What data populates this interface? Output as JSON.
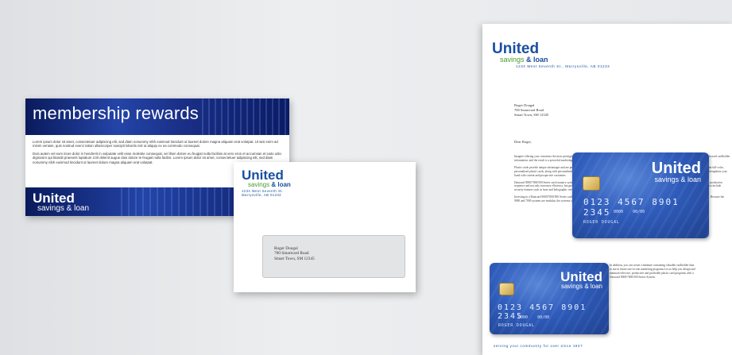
{
  "mailer": {
    "title": "membership rewards",
    "paragraph1": "Lorem ipsum dolor sit amet, consectetuer adipiscing elit, sed diam nonummy nibh euismod tincidunt ut laoreet dolore magna aliquam erat volutpat. Ut wisi enim ad minim veniam, quis nostrud exerci tation ullamcorper suscipit lobortis nisl ut aliquip ex ea commodo consequat.",
    "paragraph2": "Duis autem vel eum iriure dolor in hendrerit in vulputate velit esse molestie consequat, vel illum dolore eu feugiat nulla facilisis at vero eros et accumsan et iusto odio dignissim qui blandit praesent luptatum zzril delenit augue duis dolore te feugait nulla facilisi. Lorem ipsum dolor sit amet, consectetuer adipiscing elit, sed diam nonummy nibh euismod tincidunt ut laoreet dolore magna aliquam erat volutpat.",
    "logo_united": "United",
    "logo_sub": "savings & loan"
  },
  "envelope": {
    "logo_united": "United",
    "logo_savings": "savings",
    "logo_loan": "& loan",
    "return_line1": "1234 West Seventh St.",
    "return_line2": "Marrysville, AB 01234",
    "recipient_name": "Roger Dougal",
    "recipient_street": "700 Smartcard Road",
    "recipient_city": "Smart Town, SM 12345"
  },
  "letter": {
    "logo_united": "United",
    "logo_savings": "savings",
    "logo_loan": "& loan",
    "address": "1234 West Seventh St., Marrysville, AB 01234",
    "recipient_name": "Roger Dougal",
    "recipient_street": "700 Smartcard Road",
    "recipient_city": "Smart Town, SM 12345",
    "greeting": "Dear Roger,",
    "body1": "Imagine offering your customers the most prestigious look and feel in a plastic card. Add the ability to personalize the cards with customer photos, corporate logos and embossed cardholder information, and the result is a powerful marketing tool.",
    "body2": "Plastic cards provide unique advantages and are perceived as having greater value than paper cards. Datacard 9000/7000/500 Series card issuance systems allow you to print full-color, personalized plastic cards, along with personalized letters for your mailings. Appealing to cardholders, personalization provides the benefits of one-to-one marketing and strengthens your bond with current and prospective customers.",
    "body3": "Datacard 9000/7000/500 Series card issuance systems provide everything you need to change card design elements or messages during the personalization process, set the production sequence and not only increases efficiency, but greatly improves time to market. The cards printed by these Datacard systems are more durable than paper cards and can also include security features such as laser and holographic overlays.",
    "body4": "Investing in a Datacard 9000/7000/500 Series card issuance system is an important step toward more automated processes, such as photos, magnetic stripes or smart cards. Because the 9000 and 7000 systems are modular, the systems can grow to meet your expectation requirements.",
    "side_text": "In addition, you can create a database containing valuable cardholder data to use in future one-to-one marketing programs.Let us help you design and maintain effective, productive and profitable plastic card programs with a Datacard 9000/7000/500 Series System.",
    "footer": "serving your community for over since 1947"
  },
  "card_large": {
    "name": "United",
    "sub": "savings & loan",
    "number": "0123 4567 8901 2345",
    "valid_from": "0000",
    "valid_thru": "00/00",
    "holder": "ROGER DOUGAL"
  },
  "card_small": {
    "name": "United",
    "sub": "savings & loan",
    "number": "0123 4567 8901 2345",
    "valid_from": "0000",
    "valid_thru": "00/00",
    "holder": "ROGER DOUGAL"
  }
}
